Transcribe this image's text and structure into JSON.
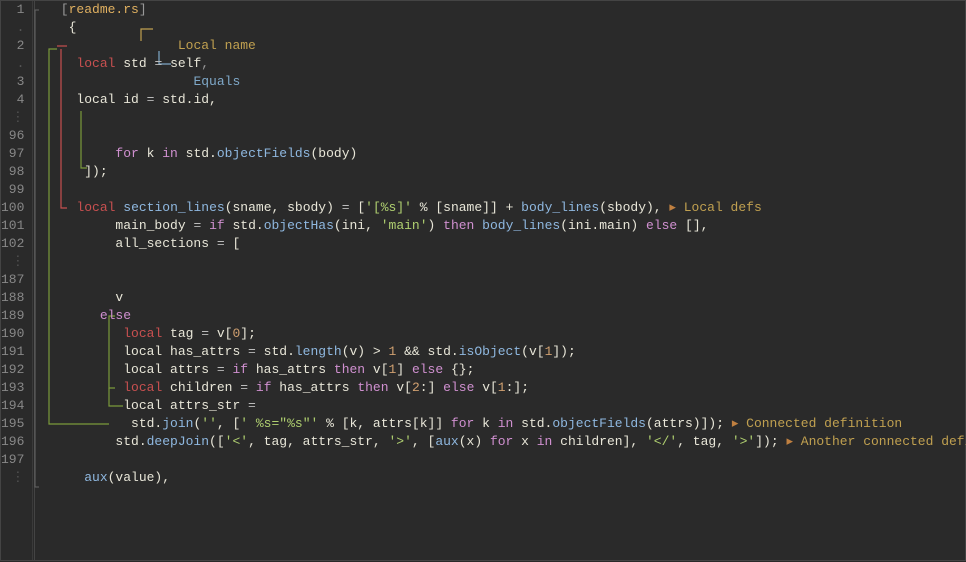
{
  "filename": "readme.rs",
  "annotations": {
    "local_name": "Local name",
    "equals": "Equals",
    "local_defs": "Local defs",
    "connected_def": "Connected definition",
    "another_connected": "Another connected definition"
  },
  "gutter": [
    "1",
    ".",
    "2",
    ".",
    "3",
    "4",
    "⋮",
    "96",
    "97",
    "98",
    "99",
    "100",
    "101",
    "102",
    "⋮",
    "187",
    "188",
    "189",
    "190",
    "191",
    "192",
    "193",
    "194",
    "195",
    "196",
    "197",
    "⋮"
  ],
  "lines": {
    "l1a": "   [",
    "l1b": "]",
    "l2": "    {",
    "l3a": "    ",
    "l3b": "local",
    "l3c": " std ",
    "l3d": "=",
    "l3e": " self",
    "l3f": ",",
    "l4a": "     local id ",
    "l4b": "=",
    "l4c": " std.id,",
    "l5": "",
    "l6a": "          ",
    "l6b": "for",
    "l6c": " k ",
    "l6d": "in",
    "l6e": " std.",
    "l6f": "objectFields",
    "l6g": "(body)",
    "l7a": "      ",
    "l7b": "]);",
    "l8": "",
    "l9a": "    ",
    "l9b": "local",
    "l9c": " ",
    "l9d": "section_lines",
    "l9e": "(sname, sbody) ",
    "l9f": "=",
    "l9g": " [",
    "l9h": "'[%s]'",
    "l9i": " % [sname]] + ",
    "l9j": "body_lines",
    "l9k": "(sbody), ",
    "l10a": "          main_body ",
    "l10b": "=",
    "l10c": " ",
    "l10d": "if",
    "l10e": " std.",
    "l10f": "objectHas",
    "l10g": "(ini, ",
    "l10h": "'main'",
    "l10i": ") ",
    "l10j": "then",
    "l10k": " ",
    "l10l": "body_lines",
    "l10m": "(ini.main) ",
    "l10n": "else",
    "l10o": " [],",
    "l11a": "          all_sections ",
    "l11b": "=",
    "l11c": " [",
    "l12": "",
    "l13": "          v",
    "l14a": "        ",
    "l14b": "else",
    "l15a": "          ",
    "l15b": "local",
    "l15c": " tag ",
    "l15d": "=",
    "l15e": " v[",
    "l15f": "0",
    "l15g": "];",
    "l16a": "           local has_attrs ",
    "l16b": "=",
    "l16c": " std.",
    "l16d": "length",
    "l16e": "(v) > ",
    "l16f": "1",
    "l16g": " && std.",
    "l16h": "isObject",
    "l16i": "(v[",
    "l16j": "1",
    "l16k": "]);",
    "l17a": "           local attrs ",
    "l17b": "=",
    "l17c": " ",
    "l17d": "if",
    "l17e": " has_attrs ",
    "l17f": "then",
    "l17g": " v[",
    "l17h": "1",
    "l17i": "] ",
    "l17j": "else",
    "l17k": " {};",
    "l18a": "          ",
    "l18b": "local",
    "l18c": " children ",
    "l18d": "=",
    "l18e": " ",
    "l18f": "if",
    "l18g": " has_attrs ",
    "l18h": "then",
    "l18i": " v[",
    "l18j": "2",
    "l18k": ":] ",
    "l18l": "else",
    "l18m": " v[",
    "l18n": "1",
    "l18o": ":];",
    "l19a": "           local attrs_str ",
    "l19b": "=",
    "l20a": "            std.",
    "l20b": "join",
    "l20c": "(",
    "l20d": "''",
    "l20e": ", [",
    "l20f": "' %s=\"%s\"'",
    "l20g": " % [k, attrs[k]] ",
    "l20h": "for",
    "l20i": " k ",
    "l20j": "in",
    "l20k": " std.",
    "l20l": "objectFields",
    "l20m": "(attrs)]); ",
    "l21a": "          std.",
    "l21b": "deepJoin",
    "l21c": "([",
    "l21d": "'<'",
    "l21e": ", tag, attrs_str, ",
    "l21f": "'>'",
    "l21g": ", [",
    "l21h": "aux",
    "l21i": "(x) ",
    "l21j": "for",
    "l21k": " x ",
    "l21l": "in",
    "l21m": " children], ",
    "l21n": "'</'",
    "l21o": ", tag, ",
    "l21p": "'>'",
    "l21q": "]); ",
    "l22": "",
    "l23a": "      ",
    "l23b": "aux",
    "l23c": "(value),"
  }
}
